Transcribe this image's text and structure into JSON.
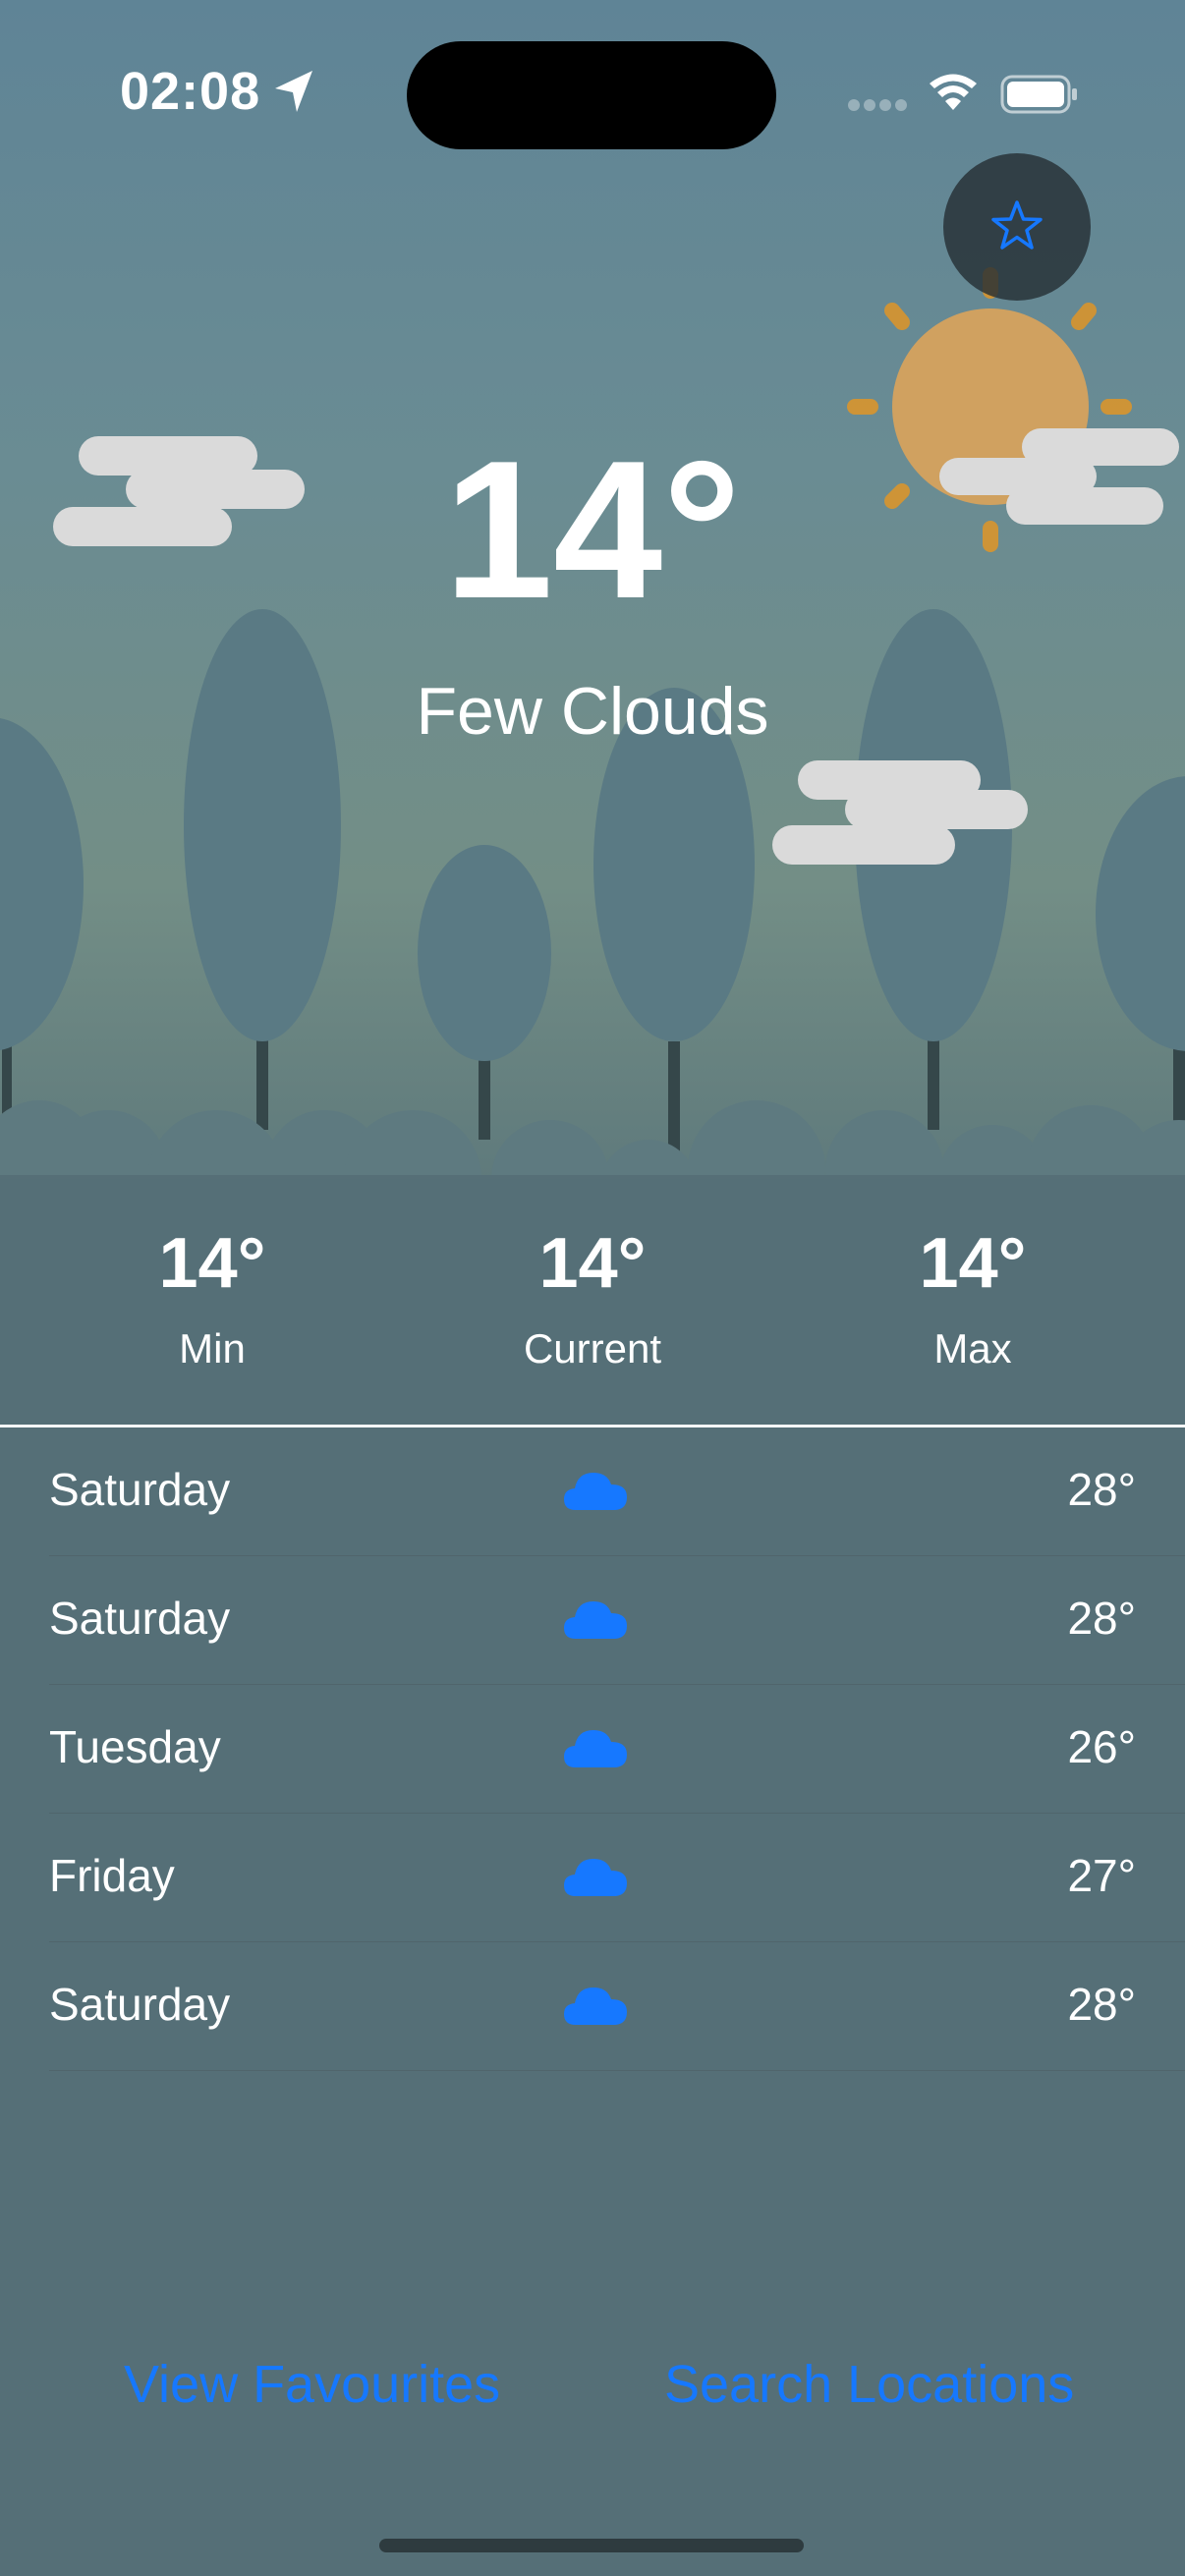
{
  "status_bar": {
    "time": "02:08"
  },
  "current": {
    "temperature": "14°",
    "condition": "Few Clouds",
    "stats": [
      {
        "value": "14°",
        "label": "Min"
      },
      {
        "value": "14°",
        "label": "Current"
      },
      {
        "value": "14°",
        "label": "Max"
      }
    ]
  },
  "forecast": [
    {
      "day": "Saturday",
      "icon": "cloud-icon",
      "temp": "28°"
    },
    {
      "day": "Saturday",
      "icon": "cloud-icon",
      "temp": "28°"
    },
    {
      "day": "Tuesday",
      "icon": "cloud-icon",
      "temp": "26°"
    },
    {
      "day": "Friday",
      "icon": "cloud-icon",
      "temp": "27°"
    },
    {
      "day": "Saturday",
      "icon": "cloud-icon",
      "temp": "28°"
    }
  ],
  "actions": {
    "view_favourites": "View Favourites",
    "search_locations": "Search Locations"
  },
  "colors": {
    "accent": "#1678ff",
    "background": "#556f77",
    "sun": "#d9a35b"
  }
}
